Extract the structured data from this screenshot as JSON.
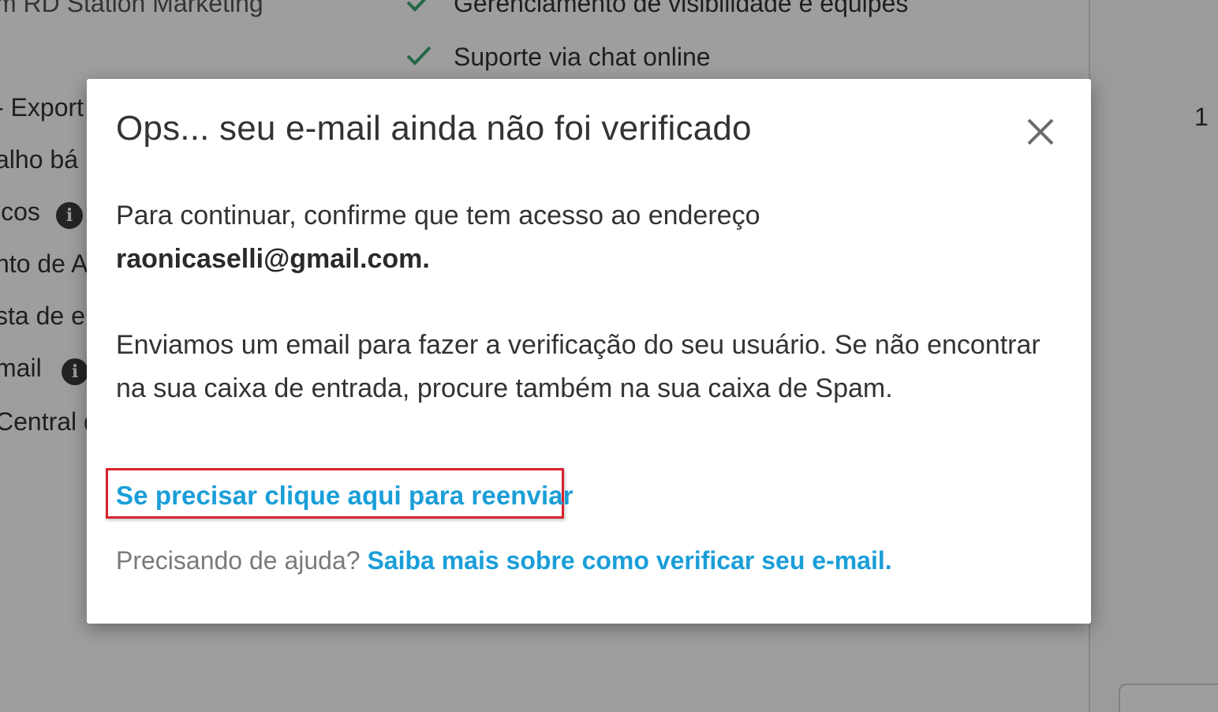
{
  "background": {
    "top_left_text": "m RD Station Marketing",
    "feature_items": [
      "Gerenciamento de visibilidade e equipes",
      "Suporte via chat online"
    ],
    "sidebar_fragments": [
      "- Export",
      "alho bá",
      "icos",
      "nto de A",
      "sta de e",
      "mail",
      "Central d"
    ],
    "right_number": "1"
  },
  "modal": {
    "title": "Ops... seu e-mail ainda não foi verificado",
    "intro_text": "Para continuar, confirme que tem acesso ao endereço",
    "email": "raonicaselli@gmail.com.",
    "info_text": "Enviamos um email para fazer a verificação do seu usuário. Se não encontrar na sua caixa de entrada, procure também na sua caixa de Spam.",
    "resend_link": "Se precisar clique aqui para reenviar",
    "help_prefix": "Precisando de ajuda?",
    "help_link": "Saiba mais sobre como verificar seu e-mail."
  },
  "icons": {
    "close": "close-icon",
    "check": "check-icon",
    "info": "info-icon"
  },
  "colors": {
    "link": "#1a9ed8",
    "highlight_border": "#d9232d",
    "check": "#3aa66f",
    "overlay": "rgba(0,0,0,0.38)"
  }
}
